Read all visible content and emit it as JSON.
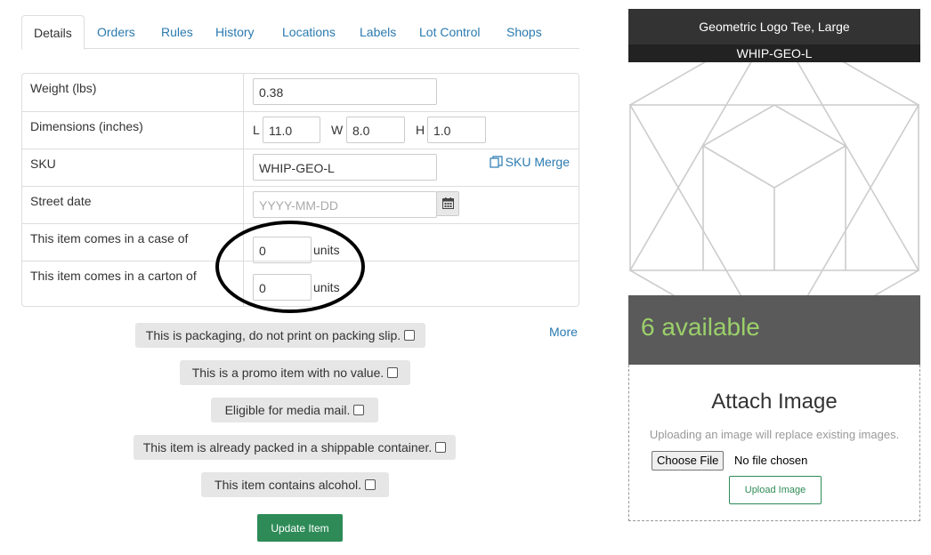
{
  "tabs": [
    {
      "label": "Details",
      "active": true
    },
    {
      "label": "Orders"
    },
    {
      "label": "Rules"
    },
    {
      "label": "History"
    },
    {
      "label": "Locations"
    },
    {
      "label": "Labels"
    },
    {
      "label": "Lot Control"
    },
    {
      "label": "Shops"
    }
  ],
  "form": {
    "weight_label": "Weight (lbs)",
    "weight_value": "0.38",
    "dimensions_label": "Dimensions (inches)",
    "dim_l_label": "L",
    "dim_l_value": "11.0",
    "dim_w_label": "W",
    "dim_w_value": "8.0",
    "dim_h_label": "H",
    "dim_h_value": "1.0",
    "sku_label": "SKU",
    "sku_value": "WHIP-GEO-L",
    "sku_merge_label": "SKU Merge",
    "street_date_label": "Street date",
    "street_date_placeholder": "YYYY-MM-DD",
    "case_label": "This item comes in a case of",
    "case_value": "0",
    "case_units": "units",
    "carton_label": "This item comes in a carton of",
    "carton_value": "0",
    "carton_units": "units"
  },
  "more_label": "More",
  "checkboxes": [
    {
      "label": "This is packaging, do not print on packing slip.",
      "checked": false
    },
    {
      "label": "This is a promo item with no value.",
      "checked": false
    },
    {
      "label": "Eligible for media mail.",
      "checked": false
    },
    {
      "label": "This item is already packed in a shippable container.",
      "checked": false
    },
    {
      "label": "This item contains alcohol.",
      "checked": false
    }
  ],
  "update_button": "Update Item",
  "product": {
    "title": "Geometric Logo Tee, Large",
    "sku": "WHIP-GEO-L",
    "available": "6 available"
  },
  "attach": {
    "title": "Attach Image",
    "hint": "Uploading an image will replace existing images.",
    "choose_file": "Choose File",
    "no_file": "No file chosen",
    "upload_button": "Upload Image"
  },
  "colors": {
    "link": "#2a7ab0",
    "primary_green": "#2e8b57",
    "available_text": "#9bd06a",
    "header_dark": "#333333"
  }
}
